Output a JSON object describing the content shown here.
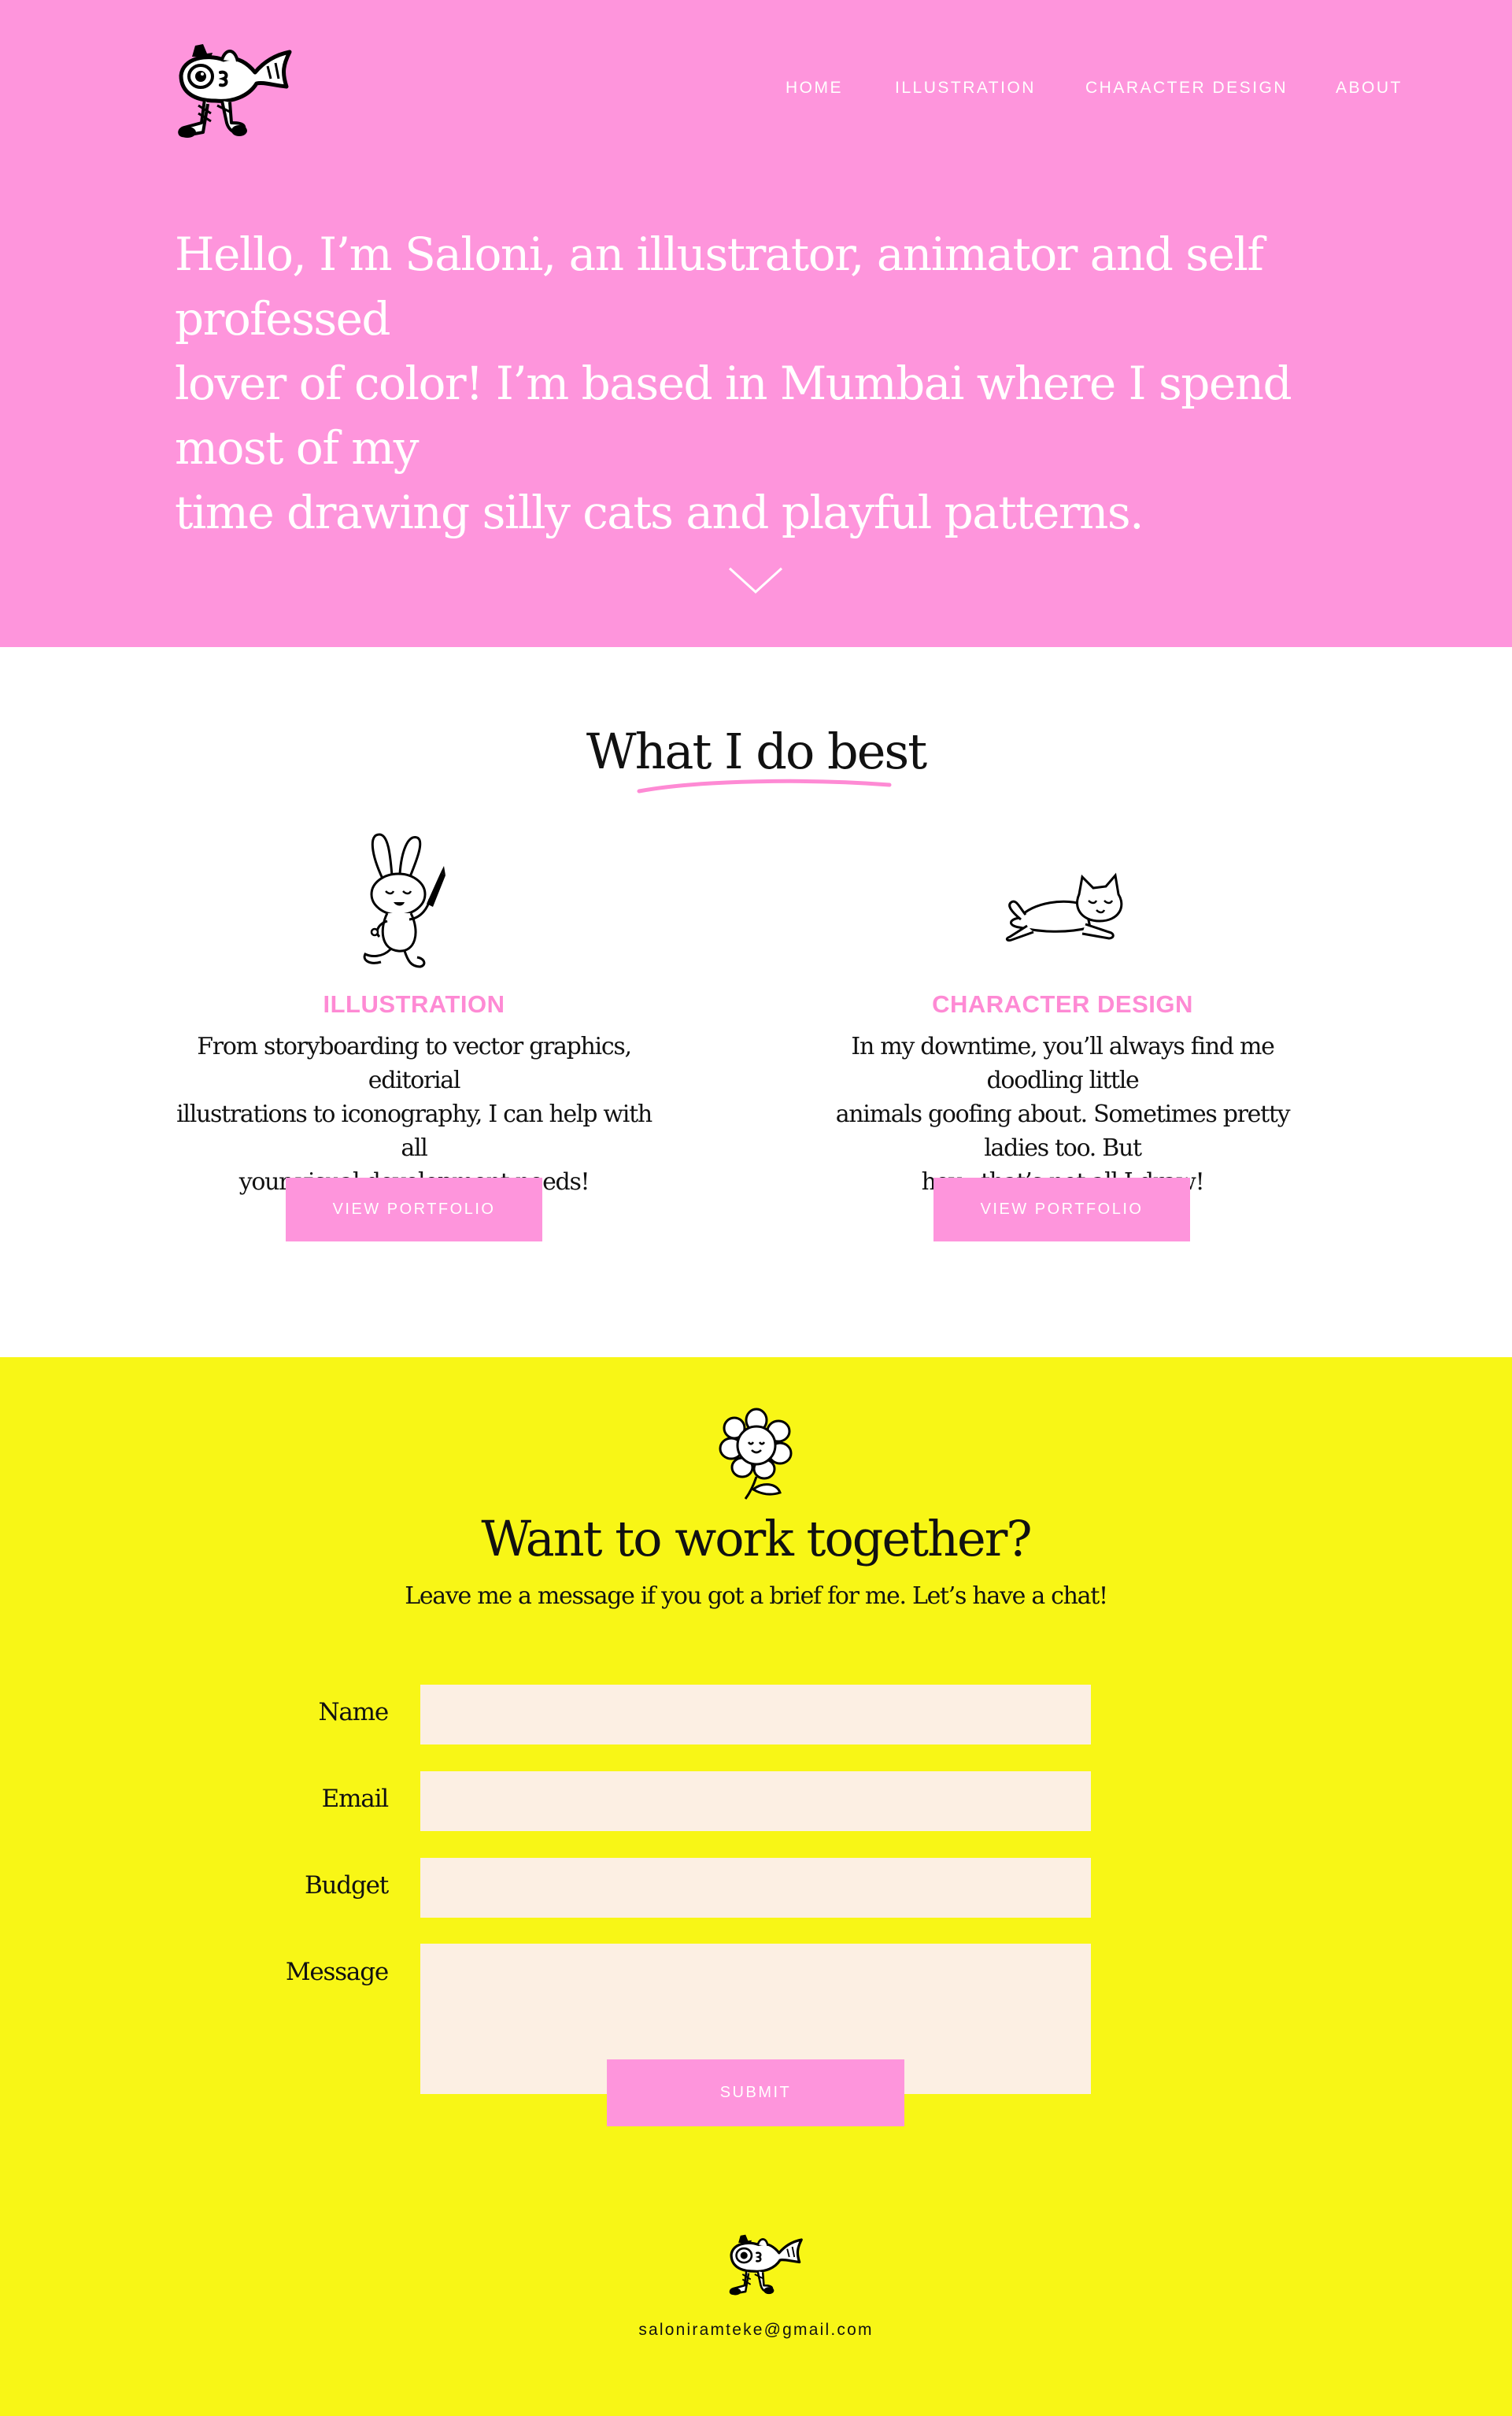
{
  "nav": {
    "items": [
      "HOME",
      "ILLUSTRATION",
      "CHARACTER DESIGN",
      "ABOUT"
    ]
  },
  "hero": {
    "lines": [
      "Hello, I’m Saloni, an illustrator, animator and self professed",
      "lover of color! I’m based in Mumbai where I spend most of my",
      "time drawing silly cats and playful patterns."
    ]
  },
  "services": {
    "heading": "What I do best",
    "items": [
      {
        "title": "ILLUSTRATION",
        "desc": [
          "From storyboarding to vector graphics, editorial",
          "illustrations to iconography, I can help with all",
          "your visual development needs!"
        ],
        "button": "VIEW PORTFOLIO",
        "icon": "bunny-drawing-icon"
      },
      {
        "title": "CHARACTER DESIGN",
        "desc": [
          "In my downtime, you’ll always find me doodling little",
          "animals goofing about. Sometimes pretty ladies too. But",
          "hey - that’s not all I draw!"
        ],
        "button": "VIEW PORTFOLIO",
        "icon": "cat-leaping-icon"
      }
    ]
  },
  "contact": {
    "heading": "Want to work together?",
    "subheading": "Leave me a message if you got a brief for me. Let’s have a chat!",
    "fields": {
      "name_label": "Name",
      "email_label": "Email",
      "budget_label": "Budget",
      "message_label": "Message",
      "name_value": "",
      "email_value": "",
      "budget_value": "",
      "message_value": ""
    },
    "submit_label": "SUBMIT"
  },
  "footer": {
    "email": "saloniramteke@gmail.com"
  },
  "colors": {
    "pink": "#fe95dc",
    "yellow": "#f8f616",
    "field": "#fcefe3"
  }
}
